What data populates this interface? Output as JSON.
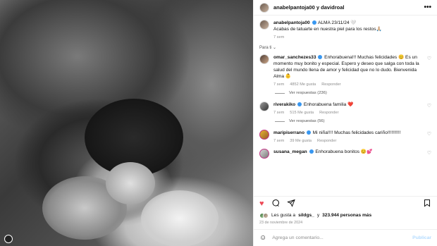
{
  "header": {
    "username": "anabelpantoja00 y davidroal",
    "more": "•••"
  },
  "caption": {
    "username": "anabelpantoja00",
    "text_line1": "ALMA 23/11/24 🤍",
    "text_line2": "Acabas de tatuarte en nuestra piel para los restos🙏🏼",
    "time": "7 sem"
  },
  "translate_label": "Para ti ⌄",
  "comments": [
    {
      "username": "omar_sanchezes33",
      "text": "Enhorabuena!!! Muchas felicidades 😊 Es un momento muy bonito y especial. Espero y deseo que salga con toda la salud del mundo llena de amor y felicidad que no lo dudo. Bienvenida Alma 👶",
      "time": "7 sem",
      "likes": "4852 Me gusta",
      "reply": "Responder",
      "view_replies": "Ver respuestas (236)"
    },
    {
      "username": "riverakiko",
      "text": "Enhorabuena familia ❤️",
      "time": "7 sem",
      "likes": "515 Me gusta",
      "reply": "Responder",
      "view_replies": "Ver respuestas (56)"
    },
    {
      "username": "maripiserrano",
      "text": "Mi niña!!!! Muchas felicidades cariño!!!!!!!!!!",
      "time": "7 sem",
      "likes": "39 Me gusta",
      "reply": "Responder"
    },
    {
      "username": "susana_megan",
      "text": "Enhorabuena bonitos 😊💕",
      "time": "",
      "likes": "",
      "reply": ""
    }
  ],
  "likes_line": {
    "prefix": "Les gusta a",
    "user": "sildgs_",
    "middle": "y",
    "count": "323.944 personas más"
  },
  "date": "23 de noviembre de 2024",
  "add_comment": {
    "placeholder": "Agrega un comentario...",
    "post": "Publicar"
  }
}
